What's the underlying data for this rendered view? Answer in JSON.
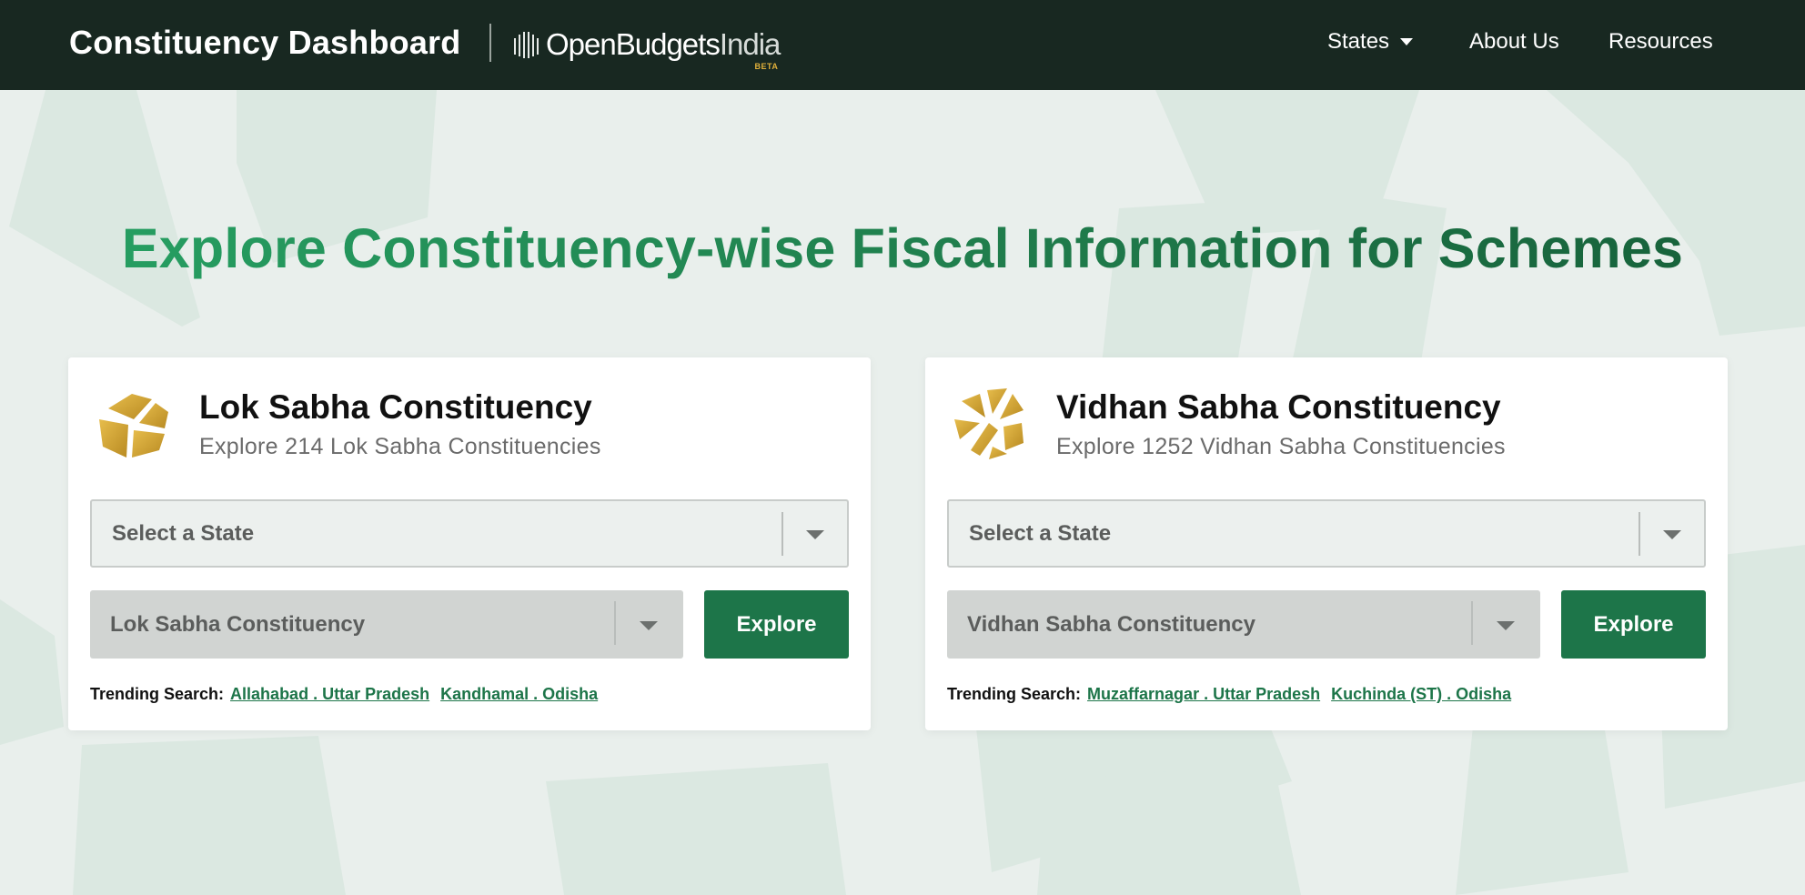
{
  "header": {
    "title": "Constituency Dashboard",
    "logo": {
      "part1": "Open",
      "part2": "Budgets",
      "part3": "India",
      "badge": "BETA"
    },
    "nav": {
      "states": "States",
      "about": "About Us",
      "resources": "Resources"
    }
  },
  "hero": {
    "title": "Explore Constituency-wise Fiscal Information for Schemes"
  },
  "cards": {
    "lok_sabha": {
      "title": "Lok Sabha Constituency",
      "subtitle": "Explore 214 Lok Sabha Constituencies",
      "state_placeholder": "Select a State",
      "constituency_placeholder": "Lok Sabha Constituency",
      "explore_label": "Explore",
      "trending_label": "Trending Search:",
      "trending": [
        "Allahabad . Uttar Pradesh",
        "Kandhamal . Odisha"
      ]
    },
    "vidhan_sabha": {
      "title": "Vidhan Sabha Constituency",
      "subtitle": "Explore 1252 Vidhan Sabha Constituencies",
      "state_placeholder": "Select a State",
      "constituency_placeholder": "Vidhan Sabha Constituency",
      "explore_label": "Explore",
      "trending_label": "Trending Search:",
      "trending": [
        "Muzaffarnagar . Uttar Pradesh",
        "Kuchinda (ST) . Odisha"
      ]
    }
  },
  "colors": {
    "header_bg": "#182821",
    "accent_green": "#1d7549",
    "hero_green": "#27a264",
    "icon_gold": "#d9a93a",
    "page_bg": "#e9efec"
  },
  "icons": {
    "lok_sabha": "lok-sabha-icon",
    "vidhan_sabha": "vidhan-sabha-icon",
    "dropdown": "chevron-down-icon"
  }
}
